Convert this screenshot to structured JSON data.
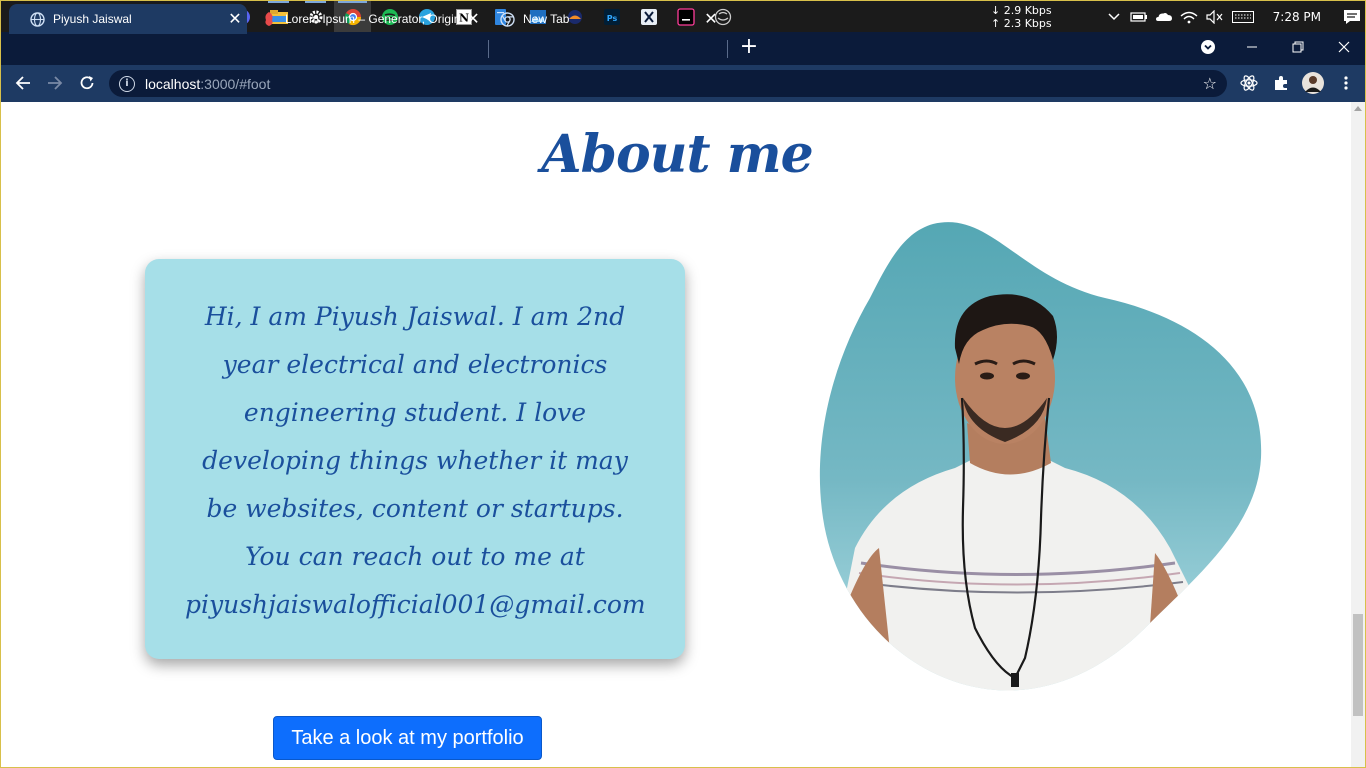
{
  "taskbar": {
    "apps": [
      {
        "name": "start-icon"
      },
      {
        "name": "search-icon"
      },
      {
        "name": "cortana-icon"
      },
      {
        "name": "task-view-icon"
      },
      {
        "name": "whatsapp-icon"
      },
      {
        "name": "defender-icon"
      },
      {
        "name": "discord-icon"
      },
      {
        "name": "file-explorer-icon"
      },
      {
        "name": "settings-icon"
      },
      {
        "name": "chrome-icon"
      },
      {
        "name": "spotify-icon"
      },
      {
        "name": "telegram-icon"
      },
      {
        "name": "notion-icon"
      },
      {
        "name": "notepad-icon"
      },
      {
        "name": "photos-icon"
      },
      {
        "name": "app-icon"
      },
      {
        "name": "photoshop-icon"
      },
      {
        "name": "capcut-icon"
      },
      {
        "name": "terminal-icon"
      },
      {
        "name": "github-icon"
      }
    ],
    "net_down": "↓ 2.9 Kbps",
    "net_up": "↑ 2.3 Kbps",
    "time": "7:28 PM"
  },
  "browser": {
    "tabs": [
      {
        "label": "Piyush Jaiswal",
        "active": true
      },
      {
        "label": "Lorem Ipsum – Generator, Origin",
        "active": false
      },
      {
        "label": "New Tab",
        "active": false
      }
    ],
    "close_glyph": "✕",
    "new_tab_glyph": "+",
    "url_host": "localhost",
    "url_rest": ":3000/#foot"
  },
  "page": {
    "title": "About me",
    "intro": "Hi, I am Piyush Jaiswal. I am 2nd year electrical and electronics engineering student. I love developing things whether it may be websites, content or startups.",
    "contact": "You can reach out to me at piyushjaiswalofficial001@gmail.com",
    "portfolio_button": "Take a look at my portfolio"
  },
  "colors": {
    "accent": "#1a4f9c",
    "card_bg": "#a6dfe8",
    "button_bg": "#0d6efd",
    "blob_top": "#55a7b4",
    "blob_bottom": "#a9dbe3"
  }
}
